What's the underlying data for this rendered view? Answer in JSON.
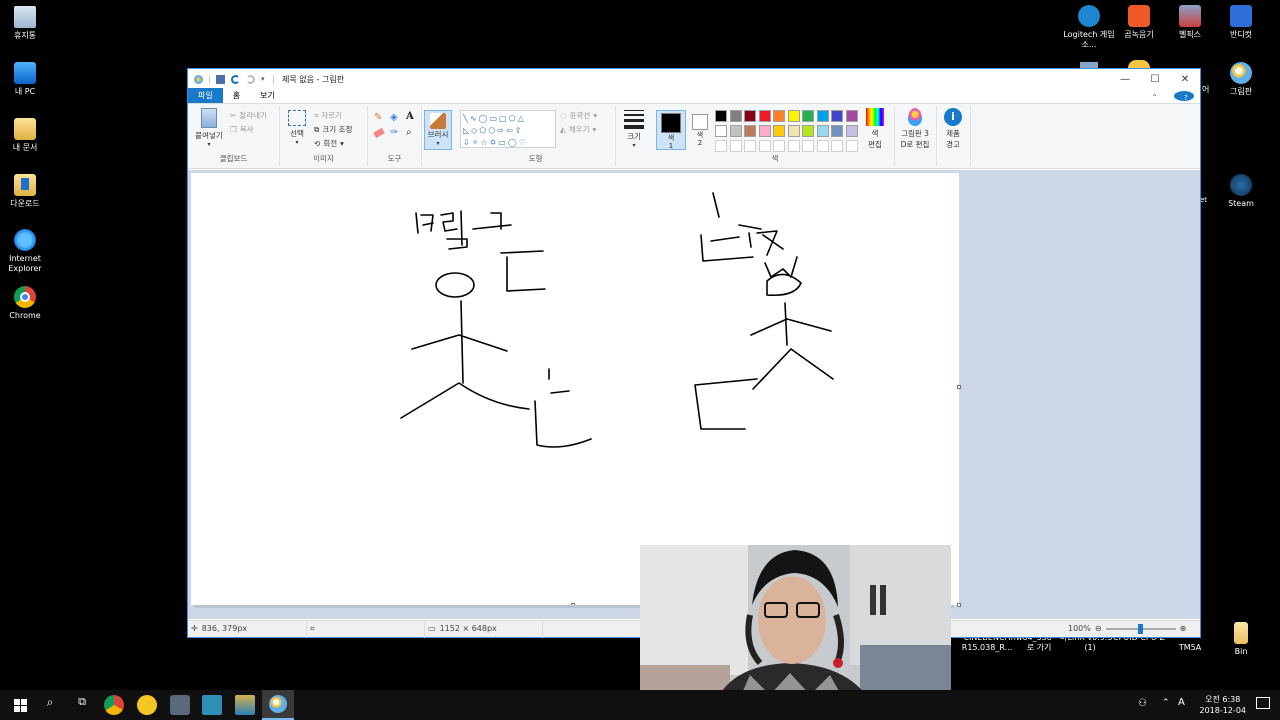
{
  "desktop": {
    "left_icons": [
      {
        "label": "휴지통",
        "icon": "recycle-bin-icon"
      },
      {
        "label": "내 PC",
        "icon": "this-pc-icon"
      },
      {
        "label": "내 문서",
        "icon": "documents-icon"
      },
      {
        "label": "다운로드",
        "icon": "downloads-icon"
      },
      {
        "label": "Internet Explorer",
        "icon": "internet-explorer-icon"
      },
      {
        "label": "Chrome",
        "icon": "chrome-icon"
      }
    ],
    "right_top_icons": [
      {
        "label": "Logitech 게임 소...",
        "icon": "logitech-icon"
      },
      {
        "label": "곰녹음기",
        "icon": "gom-recorder-icon"
      },
      {
        "label": "벨픽스",
        "icon": "bellfix-icon"
      },
      {
        "label": "반디컷",
        "icon": "bandicut-icon"
      }
    ],
    "right_side_icons": [
      {
        "label": "그림판",
        "icon": "paint-icon"
      },
      {
        "label": "Steam",
        "icon": "steam-icon"
      },
      {
        "label": "Bin",
        "icon": "folder-icon"
      }
    ],
    "partial_labels": [
      "어",
      "et"
    ],
    "bottom_icons": [
      {
        "label": "CINEBENCH R15.038_R...",
        "icon": "cinebench-icon"
      },
      {
        "label": "hw64_538 - 바로 가기",
        "icon": "hwinfo-icon"
      },
      {
        "label": "LinX v0.9.3 (1)",
        "icon": "linx-icon"
      },
      {
        "label": "CPUID CPU-Z",
        "icon": "cpuz-icon"
      },
      {
        "label": "TM5A",
        "icon": "tm5-icon"
      }
    ]
  },
  "paint": {
    "title": "제목 없음 - 그림판",
    "tabs": {
      "file": "파일",
      "home": "홈",
      "view": "보기"
    },
    "clipboard": {
      "paste": "붙여넣기",
      "cut": "잘라내기",
      "copy": "복사",
      "label": "클립보드"
    },
    "image": {
      "select": "선택",
      "crop": "자르기",
      "resize": "크기 조정",
      "rotate": "회전",
      "label": "이미지"
    },
    "tools": {
      "brush": "브러시",
      "label": "도구",
      "text_tool": "A"
    },
    "shapes": {
      "outline": "윤곽선",
      "fill": "채우기",
      "label": "도형"
    },
    "size": {
      "label": "크기"
    },
    "colors": {
      "color1": "색\n1",
      "color1_a": "색",
      "color1_b": "1",
      "color2_a": "색",
      "color2_b": "2",
      "edit_a": "색",
      "edit_b": "편집",
      "label": "색",
      "color1_value": "#000000",
      "color2_value": "#ffffff",
      "palette": [
        "#000000",
        "#7f7f7f",
        "#880015",
        "#ed1c24",
        "#ff7f27",
        "#fff200",
        "#22b14c",
        "#00a2e8",
        "#3f48cc",
        "#a349a4",
        "#ffffff",
        "#c3c3c3",
        "#b97a57",
        "#ffaec9",
        "#ffc90e",
        "#efe4b0",
        "#b5e61d",
        "#99d9ea",
        "#7092be",
        "#c8bfe7"
      ]
    },
    "paint3d": {
      "a": "그림판 3",
      "b": "D로 편집"
    },
    "product_alert": {
      "a": "제품",
      "b": "경고"
    },
    "status": {
      "cursor": "836, 379px",
      "size": "1152 × 648px",
      "zoom": "100%"
    }
  },
  "taskbar": {
    "time": "오전 6:38",
    "date": "2018-12-04",
    "ime": "A"
  }
}
